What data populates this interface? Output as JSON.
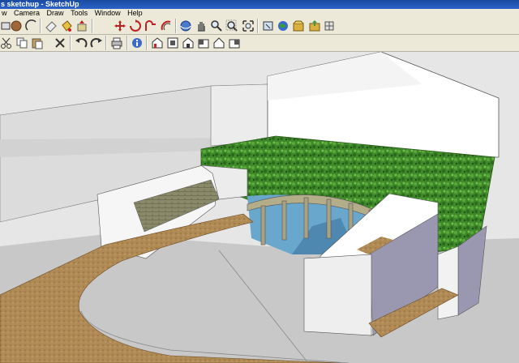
{
  "window": {
    "title": "s sketchup - SketchUp"
  },
  "menu": [
    {
      "label": "w"
    },
    {
      "label": "Camera"
    },
    {
      "label": "Draw"
    },
    {
      "label": "Tools"
    },
    {
      "label": "Window"
    },
    {
      "label": "Help"
    }
  ],
  "toolbar1": [
    "rectangle-icon",
    "circle-icon",
    "arc-icon",
    "eraser-icon",
    "paint-bucket-icon",
    "push-pull-icon",
    "move-icon",
    "rotate-icon",
    "follow-me-icon",
    "orbit-icon",
    "pan-icon",
    "zoom-icon",
    "zoom-extents-icon",
    "add-location-icon",
    "preview-google-earth-icon",
    "get-models-icon",
    "share-model-icon"
  ],
  "toolbar2": [
    "cut-icon",
    "copy-icon",
    "paste-icon",
    "delete-icon",
    "undo-icon",
    "redo-icon",
    "print-icon",
    "model-info-icon",
    "iso-view-icon",
    "top-view-icon",
    "front-view-icon",
    "right-view-icon",
    "back-view-icon",
    "left-view-icon"
  ],
  "colors": {
    "grass": "#3e8a2a",
    "path": "#b08a55",
    "wall": "#f4f4f4",
    "side_wall": "#9a98b0",
    "water": "#5d9ec6",
    "ground": "#c8c8c8"
  }
}
